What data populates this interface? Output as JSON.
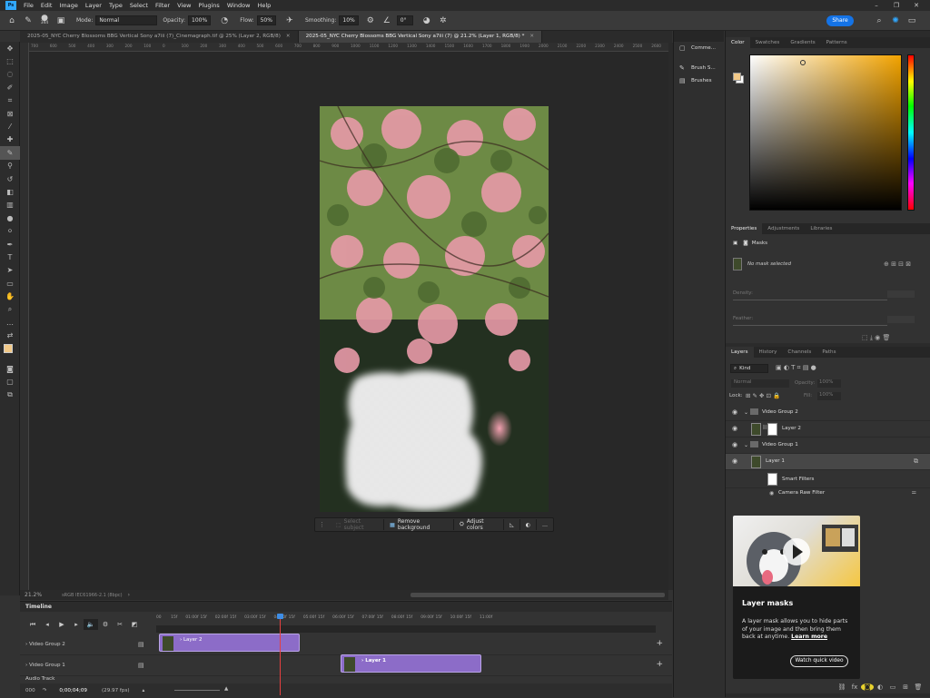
{
  "app": {
    "menus": [
      "File",
      "Edit",
      "Image",
      "Layer",
      "Type",
      "Select",
      "Filter",
      "View",
      "Plugins",
      "Window",
      "Help"
    ],
    "window_controls": [
      "–",
      "❐",
      "✕"
    ]
  },
  "options_bar": {
    "brush_size": "344",
    "mode_label": "Mode:",
    "mode_value": "Normal",
    "opacity_label": "Opacity:",
    "opacity_value": "100%",
    "flow_label": "Flow:",
    "flow_value": "50%",
    "smoothing_label": "Smoothing:",
    "smoothing_value": "10%",
    "angle_value": "0°",
    "share_label": "Share"
  },
  "tabs": [
    {
      "label": "2025-05_NYC Cherry Blossoms BBG Vertical Sony a7iii (7)_Cinemagraph.tif @ 25% (Layer 2, RGB/8)",
      "active": false
    },
    {
      "label": "2025-05_NYC Cherry Blossoms BBG Vertical Sony a7iii (7) @ 21.2% (Layer 1, RGB/8) *",
      "active": true
    }
  ],
  "ruler_ticks": [
    "700",
    "600",
    "500",
    "400",
    "300",
    "200",
    "100",
    "0",
    "100",
    "200",
    "300",
    "400",
    "500",
    "600",
    "700",
    "800",
    "900",
    "1000",
    "1100",
    "1200",
    "1300",
    "1400",
    "1500",
    "1600",
    "1700",
    "1800",
    "1900",
    "2000",
    "2100",
    "2200",
    "2300",
    "2400",
    "2500",
    "2600"
  ],
  "context_bar": {
    "select_subject": "Select subject",
    "remove_background": "Remove background",
    "adjust_colors": "Adjust colors"
  },
  "status": {
    "zoom": "21.2%",
    "profile": "sRGB IEC61966-2.1 (8bpc)"
  },
  "timeline": {
    "title": "Timeline",
    "ruler": [
      "00",
      "15f",
      "01:00f",
      "15f",
      "02:00f",
      "15f",
      "03:00f",
      "15f",
      "04:00f",
      "15f",
      "05:00f",
      "15f",
      "06:00f",
      "15f",
      "07:00f",
      "15f",
      "08:00f",
      "15f",
      "09:00f",
      "15f",
      "10:00f",
      "15f",
      "11:00f"
    ],
    "tracks": [
      {
        "name": "Video Group 2",
        "clip": "Layer 2"
      },
      {
        "name": "Video Group 1",
        "clip": "Layer 1"
      }
    ],
    "audio_track": "Audio Track",
    "timecode": "0;00;04;09",
    "fps": "(29.97 fps)",
    "frame_count": "000"
  },
  "strip": {
    "comments": "Comme...",
    "brush_settings": "Brush S...",
    "brushes": "Brushes"
  },
  "color_panel": {
    "tabs": [
      "Color",
      "Swatches",
      "Gradients",
      "Patterns"
    ],
    "fg_color": "#f2c988"
  },
  "properties_panel": {
    "tabs": [
      "Properties",
      "Adjustments",
      "Libraries"
    ],
    "section": "Masks",
    "no_mask": "No mask selected",
    "density_label": "Density:",
    "feather_label": "Feather:"
  },
  "layers_panel": {
    "tabs": [
      "Layers",
      "History",
      "Channels",
      "Paths"
    ],
    "filter_kind": "Kind",
    "blend_mode": "Normal",
    "opacity_label": "Opacity:",
    "opacity_value": "100%",
    "lock_label": "Lock:",
    "fill_label": "Fill:",
    "fill_value": "100%",
    "layers": [
      {
        "name": "Video Group 2",
        "type": "group"
      },
      {
        "name": "Layer 2",
        "type": "layer"
      },
      {
        "name": "Video Group 1",
        "type": "group"
      },
      {
        "name": "Layer 1",
        "type": "layer"
      },
      {
        "name": "Smart Filters",
        "type": "filter"
      },
      {
        "name": "Camera Raw Filter",
        "type": "filter-item"
      }
    ]
  },
  "learn_card": {
    "title": "Layer masks",
    "body_prefix": "A layer mask allows you to hide parts of your image and then bring them back at anytime.",
    "learn_more": "Learn more",
    "button": "Watch quick video"
  }
}
